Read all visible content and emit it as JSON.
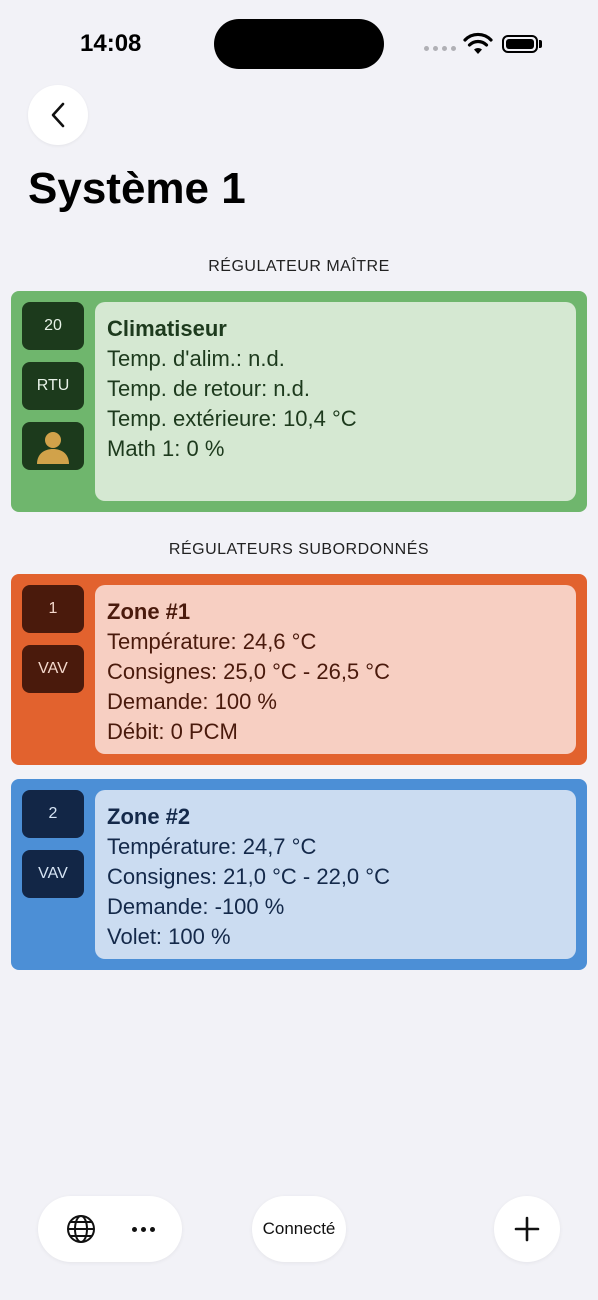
{
  "status_bar": {
    "time": "14:08"
  },
  "header": {
    "title": "Système 1"
  },
  "sections": {
    "master": "RÉGULATEUR MAÎTRE",
    "subordinates": "RÉGULATEURS SUBORDONNÉS"
  },
  "master_card": {
    "badge_address": "20",
    "badge_type": "RTU",
    "icon": "person-icon",
    "title": "Climatiseur",
    "lines": [
      "Temp. d'alim.: n.d.",
      "Temp. de retour: n.d.",
      "Temp. extérieure: 10,4 °C",
      "Math 1: 0 %"
    ],
    "color": "#6fb66d"
  },
  "zones": [
    {
      "badge_address": "1",
      "badge_type": "VAV",
      "title": "Zone #1",
      "lines": [
        "Température: 24,6 °C",
        "Consignes: 25,0 °C - 26,5 °C",
        "Demande: 100 %",
        "Débit: 0 PCM"
      ],
      "color": "#e2622e"
    },
    {
      "badge_address": "2",
      "badge_type": "VAV",
      "title": "Zone #2",
      "lines": [
        "Température: 24,7 °C",
        "Consignes: 21,0 °C - 22,0 °C",
        "Demande: -100 %",
        "Volet: 100 %"
      ],
      "color": "#4c8fd6"
    }
  ],
  "bottom_bar": {
    "globe_icon": "globe-icon",
    "more_icon": "more-icon",
    "connection_status": "Connecté",
    "add_icon": "plus-icon"
  }
}
